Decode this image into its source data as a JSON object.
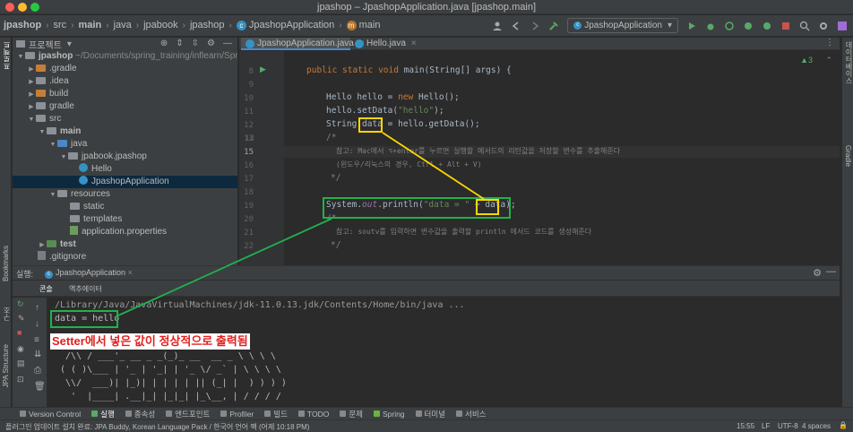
{
  "window": {
    "title": "jpashop – JpashopApplication.java [jpashop.main]"
  },
  "breadcrumb": [
    "jpashop",
    "src",
    "main",
    "java",
    "jpabook",
    "jpashop",
    "JpashopApplication",
    "main"
  ],
  "toolbar": {
    "run_config": "JpashopApplication"
  },
  "project": {
    "header": "프로젝트",
    "root": "jpashop",
    "root_path": "~/Documents/spring_training/inflearn/Spr",
    "tree": [
      {
        "label": ".gradle"
      },
      {
        "label": ".idea"
      },
      {
        "label": "build"
      },
      {
        "label": "gradle"
      },
      {
        "label": "src"
      },
      {
        "label": "main"
      },
      {
        "label": "java"
      },
      {
        "label": "jpabook.jpashop"
      },
      {
        "label": "Hello"
      },
      {
        "label": "JpashopApplication"
      },
      {
        "label": "resources"
      },
      {
        "label": "static"
      },
      {
        "label": "templates"
      },
      {
        "label": "application.properties"
      },
      {
        "label": "test"
      },
      {
        "label": ".gitignore"
      }
    ]
  },
  "editor": {
    "tabs": [
      "JpashopApplication.java",
      "Hello.java"
    ],
    "warnings": "▲3",
    "line_numbers": [
      "8",
      "9",
      "10",
      "11",
      "12",
      "13",
      "14",
      "15",
      "16",
      "17",
      "18",
      "19",
      "20",
      "21",
      "22"
    ],
    "code": {
      "l8_kw": "public static void ",
      "l8_rest": "main(String[] args) {",
      "l10_a": "Hello hello = ",
      "l10_kw": "new ",
      "l10_b": "Hello();",
      "l11_a": "hello.setData(",
      "l11_str": "\"hello\"",
      "l11_b": ");",
      "l12_a": "String ",
      "l12_b": "data",
      "l12_c": " = hello.getData();",
      "l13": "/*",
      "l14": "참고: Mac에서 ⌥+enter를 누르면 실행할 메서드의 리턴값을 저장할 변수를 추출해준다",
      "l15": "(윈도우/리눅스의 경우, Ctrl + Alt + V)",
      "l16": "*/",
      "l18_a": "System.",
      "l18_out": "out",
      "l18_b": ".println(",
      "l18_str": "\"data = \"",
      "l18_c": " + ",
      "l18_d": "data",
      "l18_e": ");",
      "l19": "/*",
      "l20": "참고: soutv를 입력하면 변수값을 출력할 println 에서드 코드를 생성해준다",
      "l21": "*/"
    }
  },
  "run_panel": {
    "label": "실행:",
    "config_tab": "JpashopApplication",
    "tabs": [
      "콘솔",
      "액추에이터"
    ],
    "console": {
      "cmd": "/Library/Java/JavaVirtualMachines/jdk-11.0.13.jdk/Contents/Home/bin/java ...",
      "output": "data = hello",
      "banner": [
        "  /\\\\ / ___'_ __ _ _(_)_ __  __ _ \\ \\ \\ \\",
        " ( ( )\\___ | '_ | '_| | '_ \\/ _` | \\ \\ \\ \\",
        "  \\\\/  ___)| |_)| | | | | || (_| |  ) ) ) )",
        "   '  |____| .__|_| |_|_| |_\\__, | / / / /"
      ]
    }
  },
  "annotation": {
    "text": "Setter에서 넣은 값이 정상적으로 출력됨"
  },
  "bottom_tools": [
    "Version Control",
    "실행",
    "종속성",
    "엔드포인트",
    "Profiler",
    "빌드",
    "TODO",
    "문제",
    "Spring",
    "터미널",
    "서비스"
  ],
  "statusbar": {
    "message": "플러그인 업데이트 설치 완료: JPA Buddy, Korean Language Pack / 한국어 언어 팩 (어제 10:18 PM)",
    "position": "15:55",
    "line_sep": "LF",
    "encoding": "UTF-8",
    "indent": "4 spaces"
  },
  "side_strips": {
    "left_top": "프로젝트",
    "left_bookmarks": "Bookmarks",
    "left_structure": "구조",
    "left_jpa": "JPA Structure",
    "right_db": "데이터베이스",
    "right_gradle": "Gradle"
  },
  "colors": {
    "annotation_yellow": "#ffd700",
    "annotation_green": "#22b14c",
    "annotation_red": "#e02020",
    "selection": "#0d293e"
  }
}
